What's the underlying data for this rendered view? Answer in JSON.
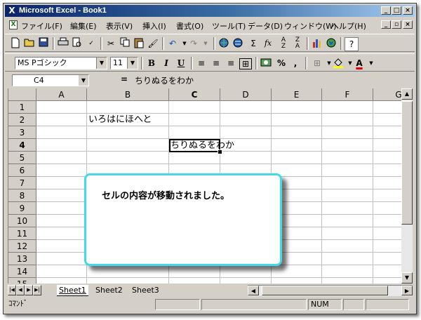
{
  "window": {
    "title": "Microsoft Excel - Book1",
    "controls": {
      "minimize": "_",
      "maximize": "□",
      "close": "×"
    }
  },
  "menu": {
    "items": [
      "ファイル(F)",
      "編集(E)",
      "表示(V)",
      "挿入(I)",
      "書式(O)",
      "ツール(T)",
      "データ(D)",
      "ウィンドウ(W)",
      "ヘルプ(H)"
    ],
    "doc_controls": {
      "minimize": "_",
      "restore": "▫",
      "close": "×"
    }
  },
  "toolbar_standard": {
    "icons": [
      "new-icon",
      "open-icon",
      "save-icon",
      "print-icon",
      "print-preview-icon",
      "spelling-icon",
      "cut-icon",
      "copy-icon",
      "paste-icon",
      "format-painter-icon",
      "undo-icon",
      "redo-icon",
      "hyperlink-icon",
      "web-toolbar-icon",
      "autosum-icon",
      "function-icon",
      "sort-ascending-icon",
      "sort-descending-icon",
      "chart-wizard-icon",
      "map-icon",
      "help-icon"
    ],
    "glyphs": {
      "autosum": "Σ",
      "function": "fx"
    }
  },
  "toolbar_format": {
    "font_name": "MS Pゴシック",
    "font_size": "11",
    "bold": "B",
    "italic": "I",
    "underline": "U",
    "currency": "%",
    "comma": ","
  },
  "formula_bar": {
    "name_box": "C4",
    "equals": "=",
    "content": "ちりぬるをわか"
  },
  "sheet": {
    "columns": [
      "A",
      "B",
      "C",
      "D",
      "E",
      "F",
      "G"
    ],
    "selected_column": "C",
    "rows": [
      "1",
      "2",
      "3",
      "4",
      "5",
      "6",
      "7",
      "8",
      "9",
      "10",
      "11",
      "12",
      "13",
      "14",
      "15"
    ],
    "selected_row": "4",
    "cells": {
      "B2": "いろはにほへと",
      "C4": "ちりぬるをわか"
    }
  },
  "tabs": [
    "Sheet1",
    "Sheet2",
    "Sheet3"
  ],
  "active_tab": "Sheet1",
  "status": {
    "mode": "ｺﾏﾝﾄﾞ",
    "num": "NUM"
  },
  "callout": {
    "message": "セルの内容が移動されました。"
  },
  "colors": {
    "title_start": "#0a246a",
    "title_end": "#a6caf0",
    "callout_border": "#44d8e8"
  }
}
